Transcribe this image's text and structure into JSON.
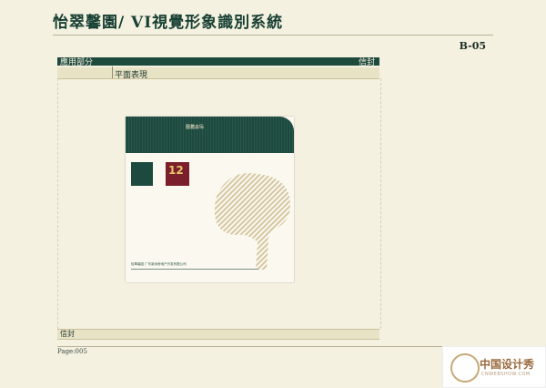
{
  "header": {
    "brand": "怡翠馨園",
    "system": "VI視覺形象識別系統",
    "code": "B-05"
  },
  "section": {
    "category": "應用部分",
    "item": "信封",
    "subtitle": "平面表現"
  },
  "footer": {
    "item": "信封",
    "page": "Page:005"
  },
  "watermark": {
    "title": "中国设计秀",
    "sub": "CNWEBSHOW.COM"
  },
  "envelope": {
    "top_text": "怡翠馨園",
    "logo_number": "12",
    "footer_text": "怡翠馨园 广东新洲房地产开发有限公司"
  }
}
